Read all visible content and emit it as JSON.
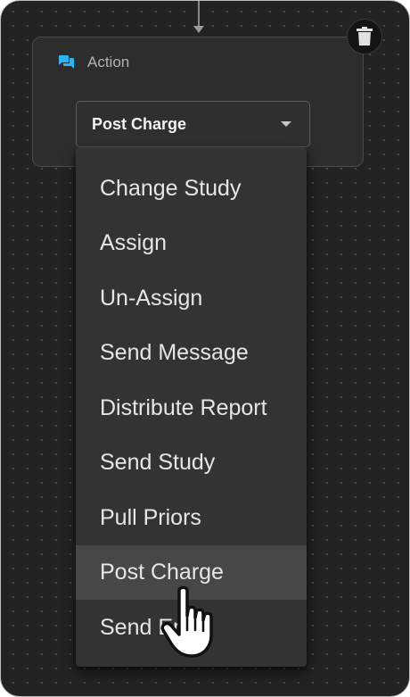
{
  "node": {
    "title": "Action",
    "icon": "chat-bubbles-icon",
    "accent_color": "#29b6f6",
    "delete_icon": "trash-icon"
  },
  "select": {
    "value": "Post Charge",
    "icon": "caret-down-icon"
  },
  "dropdown": {
    "items": [
      {
        "label": "Change Study",
        "selected": false
      },
      {
        "label": "Assign",
        "selected": false
      },
      {
        "label": "Un-Assign",
        "selected": false
      },
      {
        "label": "Send Message",
        "selected": false
      },
      {
        "label": "Distribute Report",
        "selected": false
      },
      {
        "label": "Send Study",
        "selected": false
      },
      {
        "label": "Pull Priors",
        "selected": false
      },
      {
        "label": "Post Charge",
        "selected": true
      },
      {
        "label": "Send Email",
        "selected": false
      }
    ]
  },
  "cursor": {
    "icon": "hand-pointer-icon"
  }
}
